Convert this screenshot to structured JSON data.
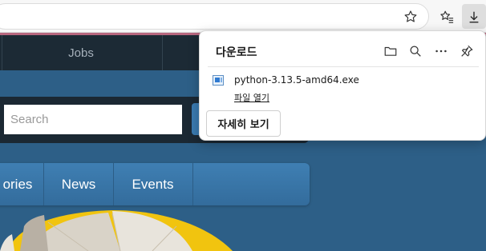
{
  "browser": {
    "favorite_icon": "star-icon",
    "favorites_icon": "favorites-list-icon",
    "downloads_icon": "download-arrow-icon"
  },
  "site": {
    "topnav": {
      "jobs_label": "Jobs"
    },
    "search": {
      "placeholder": "Search"
    },
    "mainnav": {
      "items": [
        "ories",
        "News",
        "Events"
      ]
    },
    "colors": {
      "nav_dark": "#1c2a35",
      "nav_blue": "#3f7fb3",
      "page_blue": "#2d5f87",
      "accent_pink": "#b7677f"
    }
  },
  "downloads_panel": {
    "title": "다운로드",
    "header_icons": [
      "folder-icon",
      "search-icon",
      "more-options-icon",
      "pin-icon"
    ],
    "items": [
      {
        "file_name": "python-3.13.5-amd64.exe",
        "action_label": "파일 열기"
      }
    ],
    "more_button_label": "자세히 보기"
  }
}
